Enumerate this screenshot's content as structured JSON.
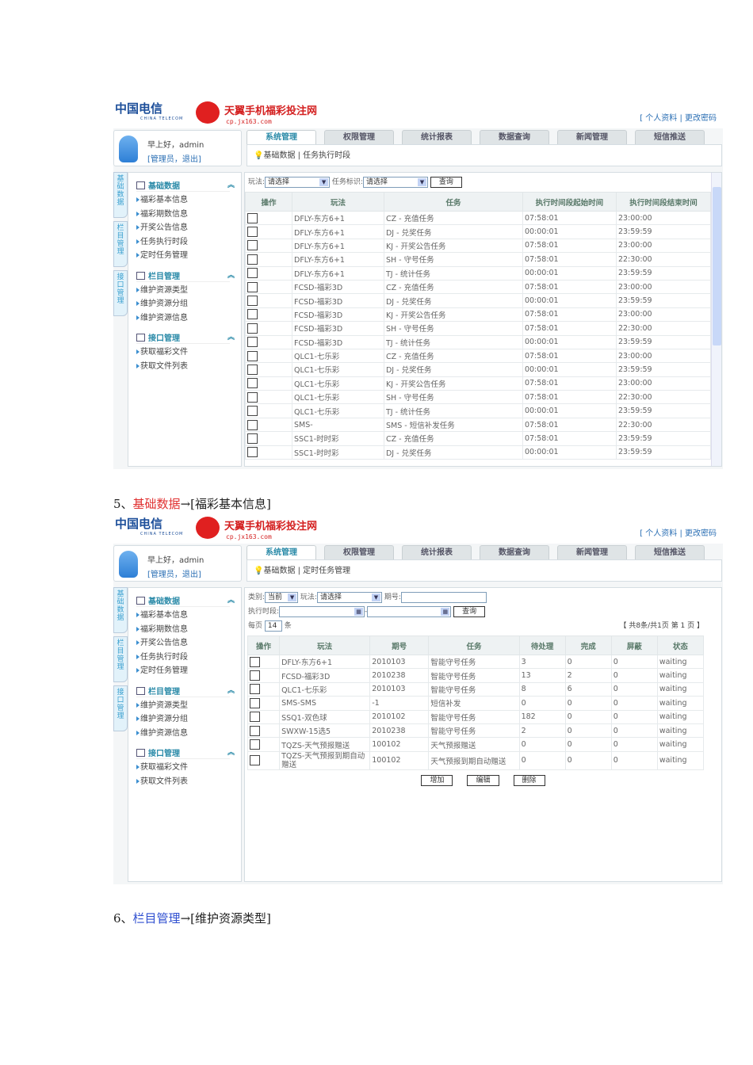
{
  "common": {
    "telecom_logo": "中国电信",
    "telecom_en": "CHINA TELECOM",
    "brand": "天翼手机福彩投注网",
    "domain": "cp.jx163.com",
    "top_links": "[ 个人资料 | 更改密码",
    "greeting": "早上好，admin",
    "role": "[管理员，退出]",
    "tabs": [
      "系统管理",
      "权限管理",
      "统计报表",
      "数据查询",
      "新闻管理",
      "短信推送"
    ],
    "vtabs": [
      "基础数据",
      "栏目管理",
      "接口管理"
    ],
    "groups": [
      {
        "title": "基础数据",
        "items": [
          "福彩基本信息",
          "福彩期数信息",
          "开奖公告信息",
          "任务执行时段",
          "定时任务管理"
        ]
      },
      {
        "title": "栏目管理",
        "items": [
          "维护资源类型",
          "维护资源分组",
          "维护资源信息"
        ]
      },
      {
        "title": "接口管理",
        "items": [
          "获取福彩文件",
          "获取文件列表"
        ]
      }
    ]
  },
  "shot1": {
    "breadcrumb": "基础数据 | 任务执行时段",
    "filter": {
      "play_label": "玩法:",
      "play_value": "请选择",
      "task_label": "任务标识:",
      "task_value": "请选择",
      "query": "查询"
    },
    "headers": [
      "操作",
      "玩法",
      "任务",
      "执行时间段起始时间",
      "执行时间段结束时间"
    ],
    "rows": [
      [
        "DFLY-东方6+1",
        "CZ - 充值任务",
        "07:58:01",
        "23:00:00"
      ],
      [
        "DFLY-东方6+1",
        "DJ - 兑奖任务",
        "00:00:01",
        "23:59:59"
      ],
      [
        "DFLY-东方6+1",
        "KJ - 开奖公告任务",
        "07:58:01",
        "23:00:00"
      ],
      [
        "DFLY-东方6+1",
        "SH - 守号任务",
        "07:58:01",
        "22:30:00"
      ],
      [
        "DFLY-东方6+1",
        "TJ - 统计任务",
        "00:00:01",
        "23:59:59"
      ],
      [
        "FCSD-福彩3D",
        "CZ - 充值任务",
        "07:58:01",
        "23:00:00"
      ],
      [
        "FCSD-福彩3D",
        "DJ - 兑奖任务",
        "00:00:01",
        "23:59:59"
      ],
      [
        "FCSD-福彩3D",
        "KJ - 开奖公告任务",
        "07:58:01",
        "23:00:00"
      ],
      [
        "FCSD-福彩3D",
        "SH - 守号任务",
        "07:58:01",
        "22:30:00"
      ],
      [
        "FCSD-福彩3D",
        "TJ - 统计任务",
        "00:00:01",
        "23:59:59"
      ],
      [
        "QLC1-七乐彩",
        "CZ - 充值任务",
        "07:58:01",
        "23:00:00"
      ],
      [
        "QLC1-七乐彩",
        "DJ - 兑奖任务",
        "00:00:01",
        "23:59:59"
      ],
      [
        "QLC1-七乐彩",
        "KJ - 开奖公告任务",
        "07:58:01",
        "23:00:00"
      ],
      [
        "QLC1-七乐彩",
        "SH - 守号任务",
        "07:58:01",
        "22:30:00"
      ],
      [
        "QLC1-七乐彩",
        "TJ - 统计任务",
        "00:00:01",
        "23:59:59"
      ],
      [
        "SMS-",
        "SMS - 短信补发任务",
        "07:58:01",
        "22:30:00"
      ],
      [
        "SSC1-时时彩",
        "CZ - 充值任务",
        "07:58:01",
        "23:59:59"
      ],
      [
        "SSC1-时时彩",
        "DJ - 兑奖任务",
        "00:00:01",
        "23:59:59"
      ]
    ]
  },
  "caption1": {
    "num": "5、",
    "link": "基础数据",
    "rest": "→[福彩基本信息]"
  },
  "shot2": {
    "breadcrumb": "基础数据 | 定时任务管理",
    "filter": {
      "type_label": "类别:",
      "type_value": "当前",
      "play_label": "玩法:",
      "play_value": "请选择",
      "issue_label": "期号:",
      "issue_value": "",
      "period_label": "执行时段:",
      "query": "查询",
      "per_page_label": "每页",
      "per_page": "14",
      "per_page_unit": "条",
      "pager": "【 共8条/共1页 第 1 页 】"
    },
    "headers": [
      "操作",
      "玩法",
      "期号",
      "任务",
      "待处理",
      "完成",
      "屏蔽",
      "状态"
    ],
    "rows": [
      [
        "DFLY-东方6+1",
        "2010103",
        "智能守号任务",
        "3",
        "0",
        "0",
        "waiting"
      ],
      [
        "FCSD-福彩3D",
        "2010238",
        "智能守号任务",
        "13",
        "2",
        "0",
        "waiting"
      ],
      [
        "QLC1-七乐彩",
        "2010103",
        "智能守号任务",
        "8",
        "6",
        "0",
        "waiting"
      ],
      [
        "SMS-SMS",
        "-1",
        "短信补发",
        "0",
        "0",
        "0",
        "waiting"
      ],
      [
        "SSQ1-双色球",
        "2010102",
        "智能守号任务",
        "182",
        "0",
        "0",
        "waiting"
      ],
      [
        "SWXW-15选5",
        "2010238",
        "智能守号任务",
        "2",
        "0",
        "0",
        "waiting"
      ],
      [
        "TQZS-天气预报赠送",
        "100102",
        "天气预报赠送",
        "0",
        "0",
        "0",
        "waiting"
      ],
      [
        "TQZS-天气预报到期自动赠送",
        "100102",
        "天气预报到期自动赠送",
        "0",
        "0",
        "0",
        "waiting"
      ]
    ],
    "buttons": [
      "增加",
      "编辑",
      "删除"
    ]
  },
  "caption2": {
    "num": "6、",
    "link": "栏目管理",
    "rest": "→[维护资源类型]"
  }
}
